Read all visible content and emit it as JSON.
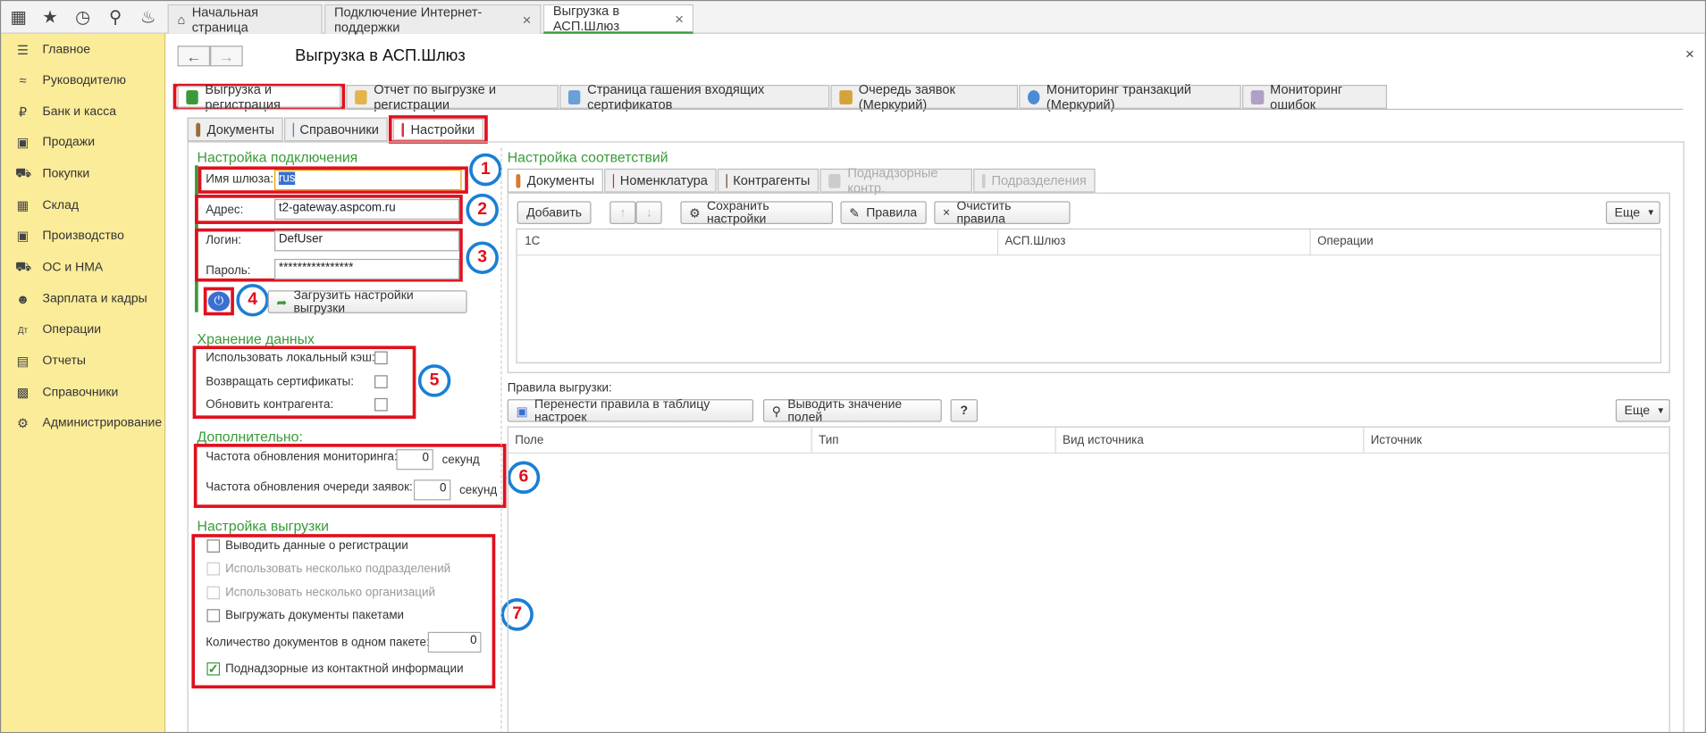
{
  "top_tabs": [
    {
      "label": "Начальная страница"
    },
    {
      "label": "Подключение Интернет-поддержки"
    },
    {
      "label": "Выгрузка в АСП.Шлюз"
    }
  ],
  "sidebar": {
    "items": [
      {
        "label": "Главное"
      },
      {
        "label": "Руководителю"
      },
      {
        "label": "Банк и касса"
      },
      {
        "label": "Продажи"
      },
      {
        "label": "Покупки"
      },
      {
        "label": "Склад"
      },
      {
        "label": "Производство"
      },
      {
        "label": "ОС и НМА"
      },
      {
        "label": "Зарплата и кадры"
      },
      {
        "label": "Операции"
      },
      {
        "label": "Отчеты"
      },
      {
        "label": "Справочники"
      },
      {
        "label": "Администрирование"
      }
    ]
  },
  "page": {
    "title": "Выгрузка в АСП.Шлюз"
  },
  "main_tabs": [
    {
      "label": "Выгрузка и регистрация"
    },
    {
      "label": "Отчет по выгрузке и регистрации"
    },
    {
      "label": "Страница гашения входящих сертификатов"
    },
    {
      "label": "Очередь заявок (Меркурий)"
    },
    {
      "label": "Мониторинг транзакций (Меркурий)"
    },
    {
      "label": "Мониторинг ошибок"
    }
  ],
  "sub_tabs": [
    {
      "label": "Документы"
    },
    {
      "label": "Справочники"
    },
    {
      "label": "Настройки"
    }
  ],
  "conn": {
    "title": "Настройка подключения",
    "gateway_label": "Имя шлюза:",
    "gateway_value": "rus",
    "address_label": "Адрес:",
    "address_value": "t2-gateway.aspcom.ru",
    "login_label": "Логин:",
    "login_value": "DefUser",
    "password_label": "Пароль:",
    "password_value": "****************",
    "load_button": "Загрузить настройки выгрузки"
  },
  "storage": {
    "title": "Хранение данных",
    "items": [
      {
        "label": "Использовать локальный кэш:"
      },
      {
        "label": "Возвращать сертификаты:"
      },
      {
        "label": "Обновить контрагента:"
      }
    ]
  },
  "extra": {
    "title": "Дополнительно:",
    "monitor_label": "Частота обновления мониторинга:",
    "monitor_value": "0",
    "queue_label": "Частота обновления очереди заявок:",
    "queue_value": "0",
    "unit": "секунд"
  },
  "export": {
    "title": "Настройка выгрузки",
    "items": [
      {
        "label": "Выводить данные о регистрации"
      },
      {
        "label": "Использовать несколько подразделений"
      },
      {
        "label": "Использовать несколько организаций"
      },
      {
        "label": "Выгружать документы пакетами"
      }
    ],
    "count_label": "Количество документов в одном пакете:",
    "count_value": "0",
    "contact_label": "Поднадзорные из контактной информации"
  },
  "mapping": {
    "title": "Настройка соответствий",
    "tabs": [
      {
        "label": "Документы"
      },
      {
        "label": "Номенклатура"
      },
      {
        "label": "Контрагенты"
      },
      {
        "label": "Поднадзорные контр."
      },
      {
        "label": "Подразделения"
      }
    ],
    "add_button": "Добавить",
    "save_button": "Сохранить настройки",
    "rules_button": "Правила",
    "clear_button": "Очистить правила",
    "more_button": "Еще",
    "columns": [
      "1С",
      "АСП.Шлюз",
      "Операции"
    ]
  },
  "rules": {
    "title": "Правила выгрузки:",
    "transfer_button": "Перенести правила в таблицу настроек",
    "show_button": "Выводить значение полей",
    "help_button": "?",
    "more_button": "Еще",
    "columns": [
      "Поле",
      "Тип",
      "Вид источника",
      "Источник"
    ]
  },
  "markers": [
    "1",
    "2",
    "3",
    "4",
    "5",
    "6",
    "7"
  ]
}
